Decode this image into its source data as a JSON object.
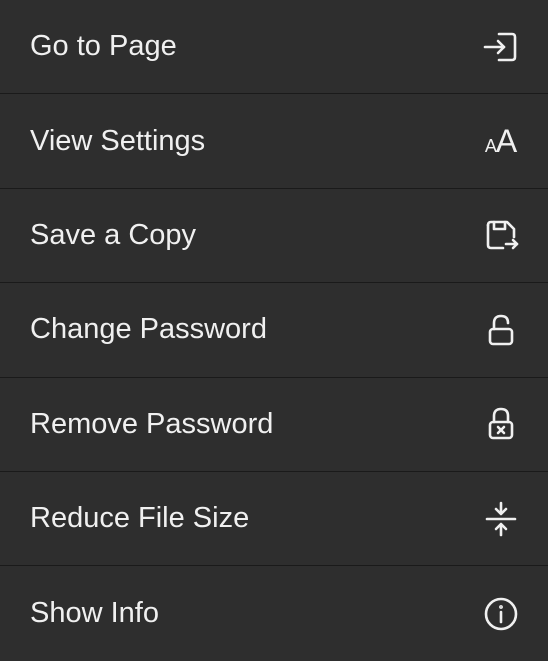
{
  "menu": {
    "items": [
      {
        "label": "Go to Page"
      },
      {
        "label": "View Settings"
      },
      {
        "label": "Save a Copy"
      },
      {
        "label": "Change Password"
      },
      {
        "label": "Remove Password"
      },
      {
        "label": "Reduce File Size"
      },
      {
        "label": "Show Info"
      }
    ]
  }
}
